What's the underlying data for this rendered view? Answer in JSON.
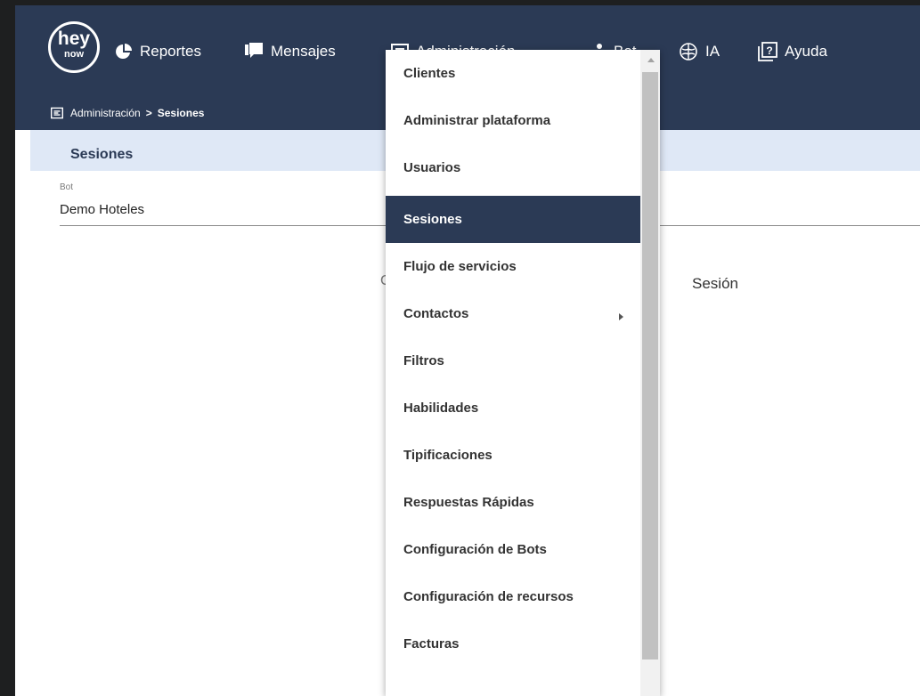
{
  "logo": {
    "line1": "hey",
    "line2": "now"
  },
  "nav": [
    {
      "label": "Reportes"
    },
    {
      "label": "Mensajes"
    },
    {
      "label": "Administración"
    },
    {
      "label": "Bot"
    },
    {
      "label": "IA"
    },
    {
      "label": "Ayuda"
    }
  ],
  "breadcrumb": {
    "parent": "Administración",
    "separator": ">",
    "current": "Sesiones"
  },
  "page": {
    "title": "Sesiones"
  },
  "bot_field": {
    "label": "Bot",
    "value": "Demo Hoteles"
  },
  "table": {
    "col_partial": "C",
    "col_sesion": "Sesión"
  },
  "menu": {
    "items": [
      {
        "label": "Clientes",
        "active": false
      },
      {
        "label": "Administrar plataforma",
        "active": false
      },
      {
        "label": "Usuarios",
        "active": false
      },
      {
        "label": "Sesiones",
        "active": true
      },
      {
        "label": "Flujo de servicios",
        "active": false
      },
      {
        "label": "Contactos",
        "active": false,
        "submenu": true
      },
      {
        "label": "Filtros",
        "active": false
      },
      {
        "label": "Habilidades",
        "active": false
      },
      {
        "label": "Tipificaciones",
        "active": false
      },
      {
        "label": "Respuestas Rápidas",
        "active": false
      },
      {
        "label": "Configuración de Bots",
        "active": false
      },
      {
        "label": "Configuración de recursos",
        "active": false
      },
      {
        "label": "Facturas",
        "active": false
      }
    ]
  },
  "colors": {
    "navbar": "#2b3a55",
    "section_bg": "#dfe8f6",
    "active_item": "#2b3a55"
  }
}
